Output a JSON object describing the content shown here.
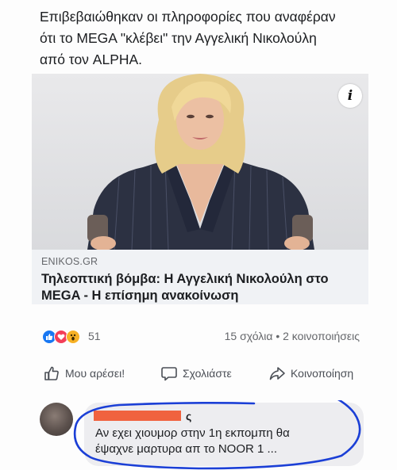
{
  "post": {
    "text_lines": [
      "Επιβεβαιώθηκαν οι πληροφορίες που αναφέραν",
      "ότι το MEGA \"κλέβει\" την Αγγελική Νικολούλη",
      "από τον ALPHA."
    ]
  },
  "link_card": {
    "image_alt": "Αγγελική Νικολούλη",
    "info_icon": "info-icon",
    "domain": "ENIKOS.GR",
    "title_lines": [
      "Τηλεοπτική βόμβα: Η Αγγελική Νικολούλη στο",
      "MEGA - Η επίσημη ανακοίνωση"
    ]
  },
  "reactions": {
    "icons": [
      "like-icon",
      "love-icon",
      "wow-icon"
    ],
    "count": "51",
    "engagement": "15 σχόλια • 2 κοινοποιήσεις"
  },
  "actions": {
    "like": "Μου αρέσει!",
    "comment": "Σχολιάστε",
    "share": "Κοινοποίηση"
  },
  "comment": {
    "name_suffix": "ς",
    "text_lines": [
      "Αν εχει χιουμορ στην 1η εκπομπη θα",
      "έψαχνε μαρτυρα απ το NOOR 1 ..."
    ]
  },
  "colors": {
    "like_blue": "#1877f2",
    "love_red": "#f33e58",
    "wow_yellow": "#f7b125",
    "annotation_blue": "#1b3fd6",
    "redaction_orange": "#f0623f"
  }
}
